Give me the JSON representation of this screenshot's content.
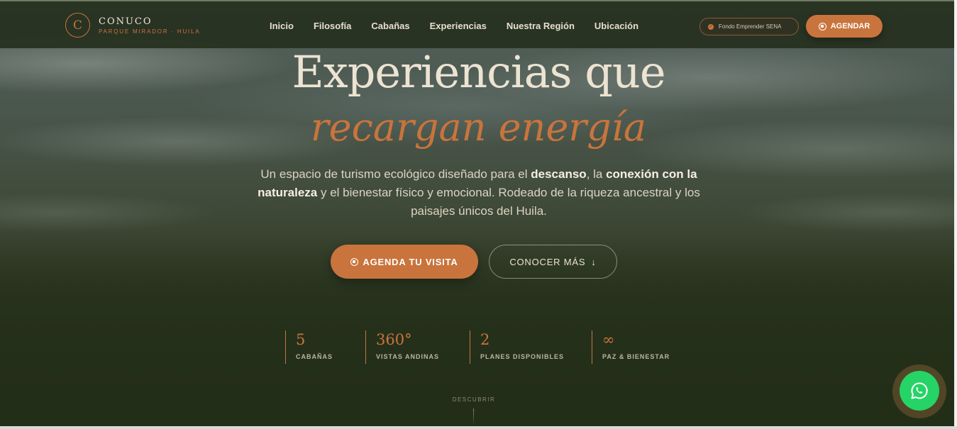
{
  "header": {
    "logo_letter": "C",
    "logo_name": "CONUCO",
    "logo_sub": "PARQUE MIRADOR · HUILA",
    "nav": [
      "Inicio",
      "Filosofía",
      "Cabañas",
      "Experiencias",
      "Nuestra Región",
      "Ubicación"
    ],
    "sena_badge": "Fondo Emprender SENA",
    "cta": "AGENDAR"
  },
  "hero": {
    "title_line1": "Experiencias que",
    "title_line2": "recargan energía",
    "desc_part1": "Un espacio de turismo ecológico diseñado para el ",
    "desc_bold1": "descanso",
    "desc_part2": ", la ",
    "desc_bold2": "conexión con la naturaleza",
    "desc_part3": " y el bienestar físico y emocional. Rodeado de la riqueza ancestral y los paisajes únicos del Huila.",
    "primary_button": "AGENDA TU VISITA",
    "secondary_button": "CONOCER MÁS"
  },
  "stats": [
    {
      "number": "5",
      "label": "CABAÑAS"
    },
    {
      "number": "360°",
      "label": "VISTAS ANDINAS"
    },
    {
      "number": "2",
      "label": "PLANES DISPONIBLES"
    },
    {
      "number": "∞",
      "label": "PAZ & BIENESTAR"
    }
  ],
  "discover": "DESCUBRIR",
  "colors": {
    "accent": "#c9743c",
    "header_bg": "#26301e",
    "whatsapp": "#25d366"
  },
  "icons": [
    "whatsapp-icon",
    "arrow-down-icon",
    "check-badge-icon"
  ]
}
